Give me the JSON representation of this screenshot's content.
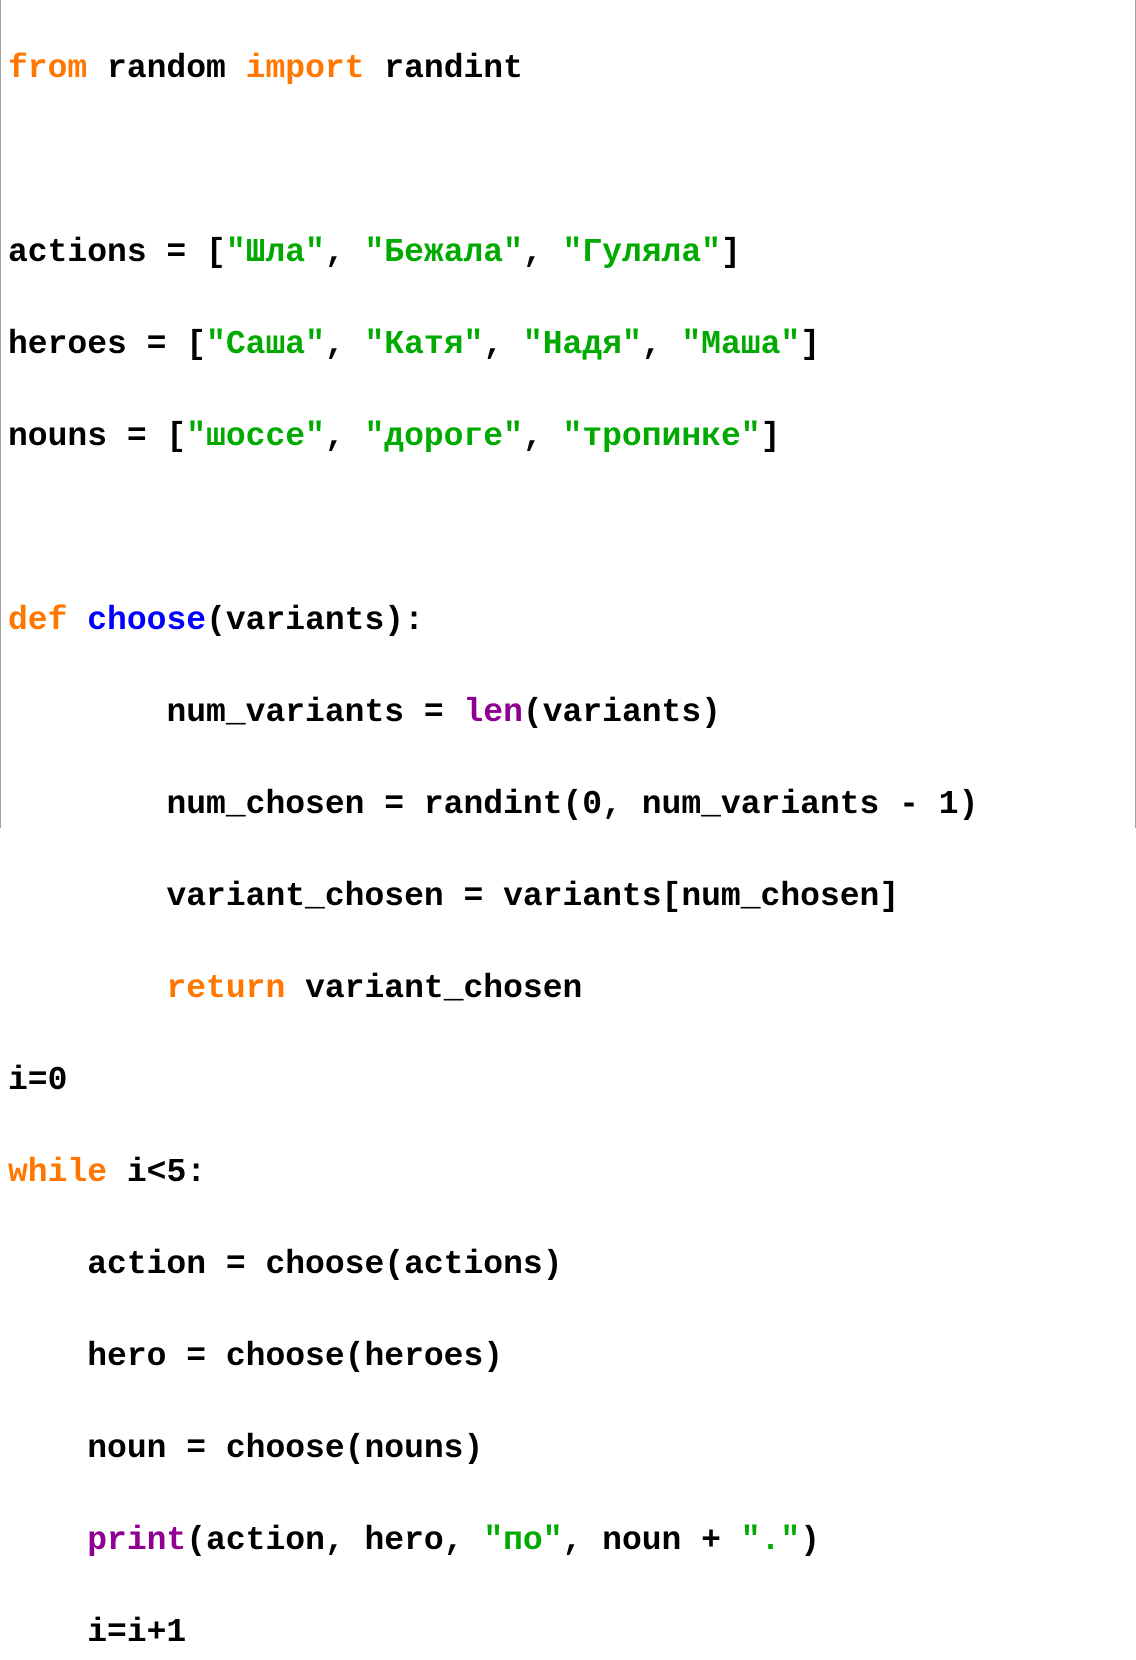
{
  "colors": {
    "keyword": "#ff7700",
    "string": "#00aa00",
    "function_name": "#0000ff",
    "builtin": "#900090",
    "text": "#000000",
    "background": "#ffffff"
  },
  "code": {
    "l1": {
      "kw_from": "from",
      "t1": " random ",
      "kw_import": "import",
      "t2": " randint"
    },
    "l3": {
      "t1": "actions = [",
      "s1": "\"Шла\"",
      "t2": ", ",
      "s2": "\"Бежала\"",
      "t3": ", ",
      "s3": "\"Гуляла\"",
      "t4": "]"
    },
    "l4": {
      "t1": "heroes = [",
      "s1": "\"Саша\"",
      "t2": ", ",
      "s2": "\"Катя\"",
      "t3": ", ",
      "s3": "\"Надя\"",
      "t4": ", ",
      "s4": "\"Маша\"",
      "t5": "]"
    },
    "l5": {
      "t1": "nouns = [",
      "s1": "\"шоссе\"",
      "t2": ", ",
      "s2": "\"дороге\"",
      "t3": ", ",
      "s3": "\"тропинке\"",
      "t4": "]"
    },
    "l7": {
      "kw_def": "def",
      "t1": " ",
      "fn": "choose",
      "t2": "(variants):"
    },
    "l8": {
      "indent": "        ",
      "t1": "num_variants = ",
      "bi_len": "len",
      "t2": "(variants)"
    },
    "l9": {
      "indent": "        ",
      "t1": "num_chosen = randint(0, num_variants - 1)"
    },
    "l10": {
      "indent": "        ",
      "t1": "variant_chosen = variants[num_chosen]"
    },
    "l11": {
      "indent": "        ",
      "kw_return": "return",
      "t1": " variant_chosen"
    },
    "l12": {
      "t1": "i=0"
    },
    "l13": {
      "kw_while": "while",
      "t1": " i<5:"
    },
    "l14": {
      "indent": "    ",
      "t1": "action = choose(actions)"
    },
    "l15": {
      "indent": "    ",
      "t1": "hero = choose(heroes)"
    },
    "l16": {
      "indent": "    ",
      "t1": "noun = choose(nouns)"
    },
    "l17": {
      "indent": "    ",
      "bi_print": "print",
      "t1": "(action, hero, ",
      "s1": "\"по\"",
      "t2": ", noun + ",
      "s2": "\".\"",
      "t3": ")"
    },
    "l18": {
      "indent": "    ",
      "t1": "i=i+1"
    }
  }
}
